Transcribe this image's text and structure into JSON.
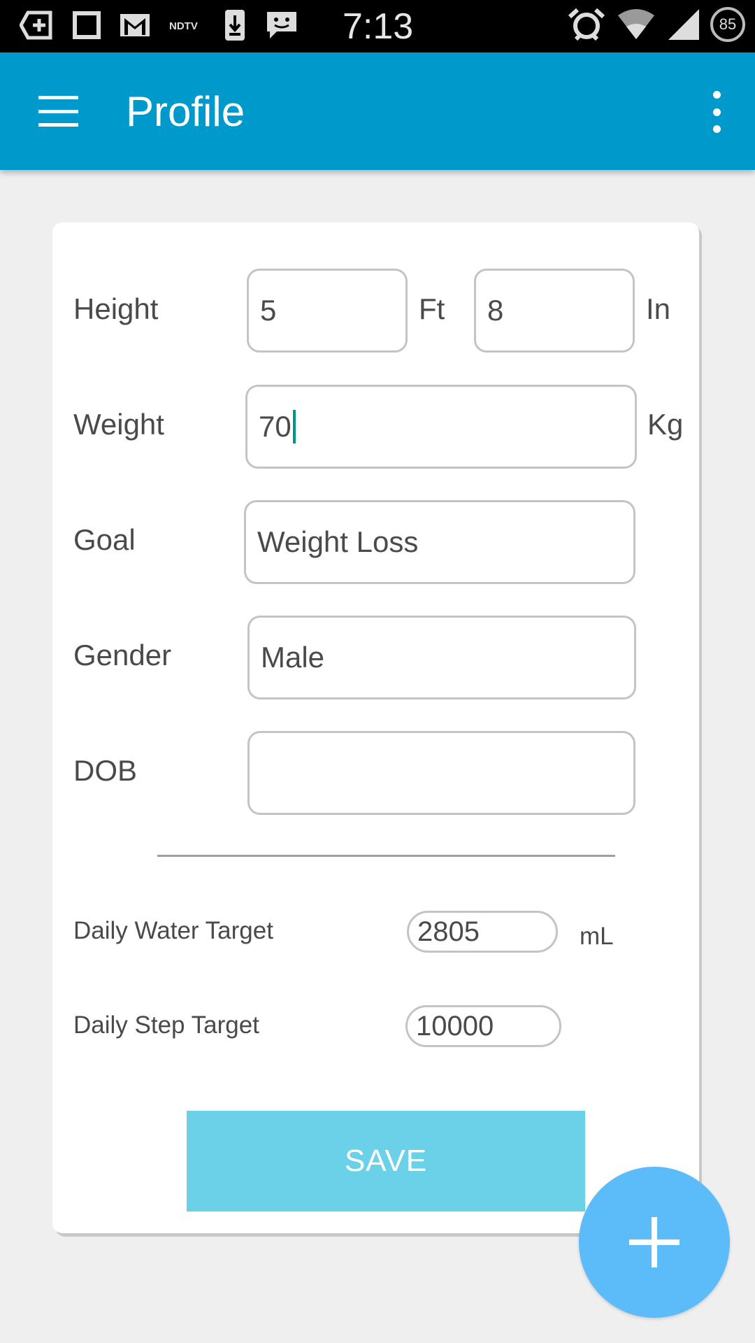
{
  "status_bar": {
    "time": "7:13",
    "battery": "85",
    "left_icons": [
      "add-box-icon",
      "square-icon",
      "gmail-icon",
      "ndtv-icon",
      "download-icon",
      "chat-icon"
    ],
    "right_icons": [
      "alarm-icon",
      "wifi-icon",
      "signal-icon"
    ]
  },
  "app_bar": {
    "title": "Profile",
    "menu_icon": "hamburger-menu-icon",
    "overflow_icon": "more-vert-icon"
  },
  "form": {
    "height": {
      "label": "Height",
      "feet": "5",
      "feet_unit": "Ft",
      "inches": "8",
      "inches_unit": "In"
    },
    "weight": {
      "label": "Weight",
      "value": "70",
      "unit": "Kg"
    },
    "goal": {
      "label": "Goal",
      "value": "Weight Loss"
    },
    "gender": {
      "label": "Gender",
      "value": "Male"
    },
    "dob": {
      "label": "DOB",
      "value": ""
    },
    "water": {
      "label": "Daily Water Target",
      "value": "2805",
      "unit": "mL"
    },
    "steps": {
      "label": "Daily Step Target",
      "value": "10000"
    }
  },
  "save_label": "SAVE",
  "fab_icon": "plus-icon",
  "colors": {
    "app_bar": "#0099cc",
    "save_button": "#6bd1e8",
    "fab": "#5bbcf9",
    "cursor": "#009688"
  }
}
